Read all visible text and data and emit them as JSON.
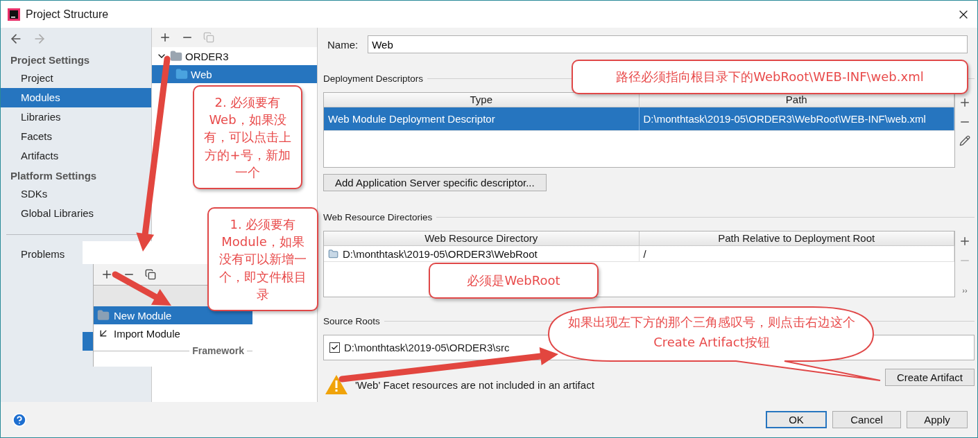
{
  "window": {
    "title": "Project Structure"
  },
  "sidebar": {
    "sections": [
      {
        "heading": "Project Settings",
        "items": [
          {
            "label": "Project",
            "selected": false
          },
          {
            "label": "Modules",
            "selected": true
          },
          {
            "label": "Libraries",
            "selected": false
          },
          {
            "label": "Facets",
            "selected": false
          },
          {
            "label": "Artifacts",
            "selected": false
          }
        ]
      },
      {
        "heading": "Platform Settings",
        "items": [
          {
            "label": "SDKs",
            "selected": false
          },
          {
            "label": "Global Libraries",
            "selected": false
          }
        ]
      }
    ],
    "problems": "Problems"
  },
  "module_tree": {
    "items": [
      {
        "label": "ORDER3",
        "expanded": true,
        "selected": false,
        "children": [
          {
            "label": "Web",
            "selected": true
          }
        ]
      }
    ]
  },
  "new_menu": {
    "items": [
      {
        "label": "New Module",
        "selected": true
      },
      {
        "label": "Import Module",
        "selected": false
      }
    ],
    "separator": "Framework"
  },
  "name_field": {
    "label": "Name:",
    "value": "Web"
  },
  "deployment_descriptors": {
    "title": "Deployment Descriptors",
    "columns": [
      "Type",
      "Path"
    ],
    "rows": [
      {
        "cells": [
          "Web Module Deployment Descriptor",
          "D:\\monthtask\\2019-05\\ORDER3\\WebRoot\\WEB-INF\\web.xml"
        ],
        "selected": true
      }
    ],
    "button": "Add Application Server specific descriptor..."
  },
  "web_resource_directories": {
    "title": "Web Resource Directories",
    "columns": [
      "Web Resource Directory",
      "Path Relative to Deployment Root"
    ],
    "rows": [
      {
        "cells": [
          "D:\\monthtask\\2019-05\\ORDER3\\WebRoot",
          "/"
        ],
        "selected": false
      }
    ],
    "more": "››"
  },
  "source_roots": {
    "title": "Source Roots",
    "items": [
      {
        "path": "D:\\monthtask\\2019-05\\ORDER3\\src",
        "checked": true
      }
    ]
  },
  "warning": {
    "text": "'Web' Facet resources are not included in an artifact",
    "button": "Create Artifact"
  },
  "footer": {
    "buttons": [
      {
        "label": "OK",
        "default": true
      },
      {
        "label": "Cancel",
        "default": false
      },
      {
        "label": "Apply",
        "default": false
      }
    ]
  },
  "annotations": [
    {
      "kind": "box",
      "text": "2. 必须要有Web，如果没有，可以点击上方的+号，新加一个"
    },
    {
      "kind": "box",
      "text": "1.  必须要有Module，如果没有可以新增一个，即文件根目录"
    },
    {
      "kind": "box",
      "text": "路径必须指向根目录下的WebRoot\\WEB-INF\\web.xml"
    },
    {
      "kind": "box",
      "text": "必须是WebRoot"
    },
    {
      "kind": "bubble",
      "text": "如果出现左下方的那个三角感叹号，则点击右边这个Create Artifact按钮"
    }
  ]
}
